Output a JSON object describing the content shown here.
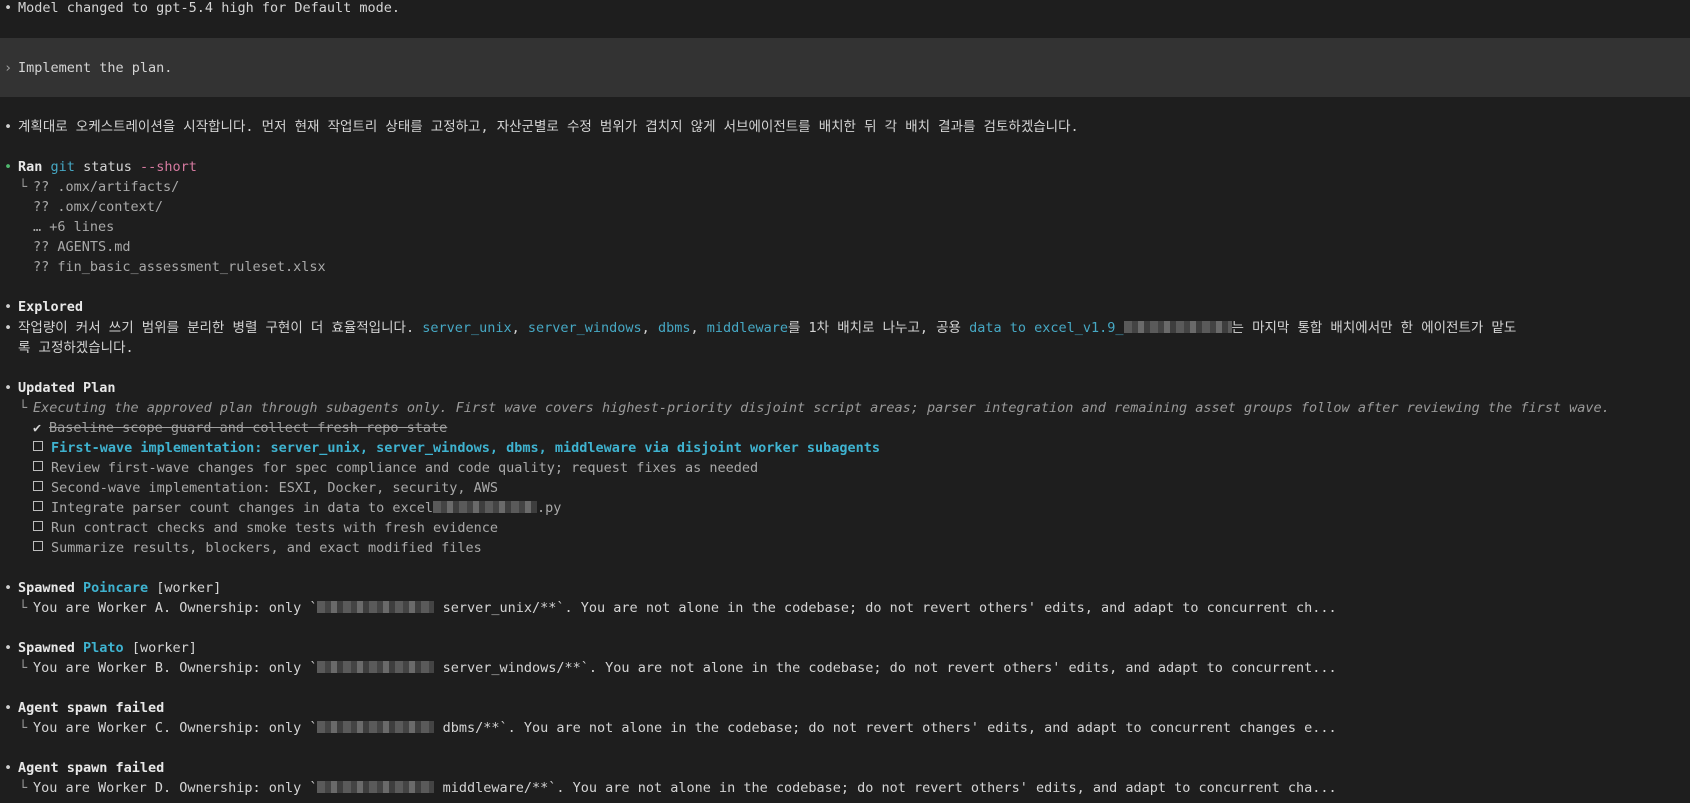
{
  "status_line": "Model changed to gpt-5.4 high for Default mode.",
  "prompt": {
    "marker": "›",
    "text": "Implement the plan."
  },
  "intro": "계획대로 오케스트레이션을 시작합니다. 먼저 현재 작업트리 상태를 고정하고, 자산군별로 수정 범위가 겹치지 않게 서브에이전트를 배치한 뒤 각 배치 결과를 검토하겠습니다.",
  "ran": {
    "label": "Ran",
    "cmd": "git",
    "args": "status",
    "flag": "--short",
    "output": [
      "?? .omx/artifacts/",
      "?? .omx/context/",
      "… +6 lines",
      "?? AGENTS.md",
      "?? fin_basic_assessment_ruleset.xlsx"
    ]
  },
  "explored": {
    "label": "Explored",
    "text_a": "작업량이 커서 쓰기 범위를 분리한 병렬 구현이 더 효율적입니다. ",
    "code_1": "server_unix",
    "sep_1": ", ",
    "code_2": "server_windows",
    "sep_2": ", ",
    "code_3": "dbms",
    "sep_3": ", ",
    "code_4": "middleware",
    "text_b": "를 1차 배치로 나누고, 공용 ",
    "code_5": "data to excel_v1.9_",
    "text_c": "는 마지막 통합 배치에서만 한 에이전트가 맡도",
    "text_d": "록 고정하겠습니다."
  },
  "plan": {
    "label": "Updated Plan",
    "note": "Executing the approved plan through subagents only. First wave covers highest-priority disjoint script areas; parser integration and remaining asset groups follow after reviewing the first wave.",
    "check_mark": "✔",
    "items": [
      {
        "text": "Baseline scope guard and collect fresh repo state",
        "state": "done"
      },
      {
        "text": "First-wave implementation: server_unix, server_windows, dbms, middleware via disjoint worker subagents",
        "state": "active"
      },
      {
        "text": "Review first-wave changes for spec compliance and code quality; request fixes as needed",
        "state": "pending"
      },
      {
        "text": "Second-wave implementation: ESXI, Docker, security, AWS",
        "state": "pending"
      },
      {
        "text": "Integrate parser count changes in data to excel",
        "suffix": ".py",
        "state": "pending"
      },
      {
        "text": "Run contract checks and smoke tests with fresh evidence",
        "state": "pending"
      },
      {
        "text": "Summarize results, blockers, and exact modified files",
        "state": "pending"
      }
    ]
  },
  "agents": [
    {
      "status": "Spawned",
      "name": "Poincare",
      "role": "[worker]",
      "prefix": "You are Worker A. Ownership: only `",
      "path": "server_unix/**`. You are not alone in the codebase; do not revert others' edits, and adapt to concurrent ch..."
    },
    {
      "status": "Spawned",
      "name": "Plato",
      "role": "[worker]",
      "prefix": "You are Worker B. Ownership: only `",
      "path": "server_windows/**`. You are not alone in the codebase; do not revert others' edits, and adapt to concurrent..."
    },
    {
      "status": "Agent spawn failed",
      "name": "",
      "role": "",
      "prefix": "You are Worker C. Ownership: only `",
      "path": "dbms/**`. You are not alone in the codebase; do not revert others' edits, and adapt to concurrent changes e..."
    },
    {
      "status": "Agent spawn failed",
      "name": "",
      "role": "",
      "prefix": "You are Worker D. Ownership: only `",
      "path": "middleware/**`. You are not alone in the codebase; do not revert others' edits, and adapt to concurrent cha..."
    }
  ],
  "colors": {
    "background": "#1e1e1e",
    "prompt_band": "#333333",
    "accent_cyan": "#3fb3d0",
    "success_green": "#4fb86e",
    "flag_pink": "#d67aa0"
  }
}
